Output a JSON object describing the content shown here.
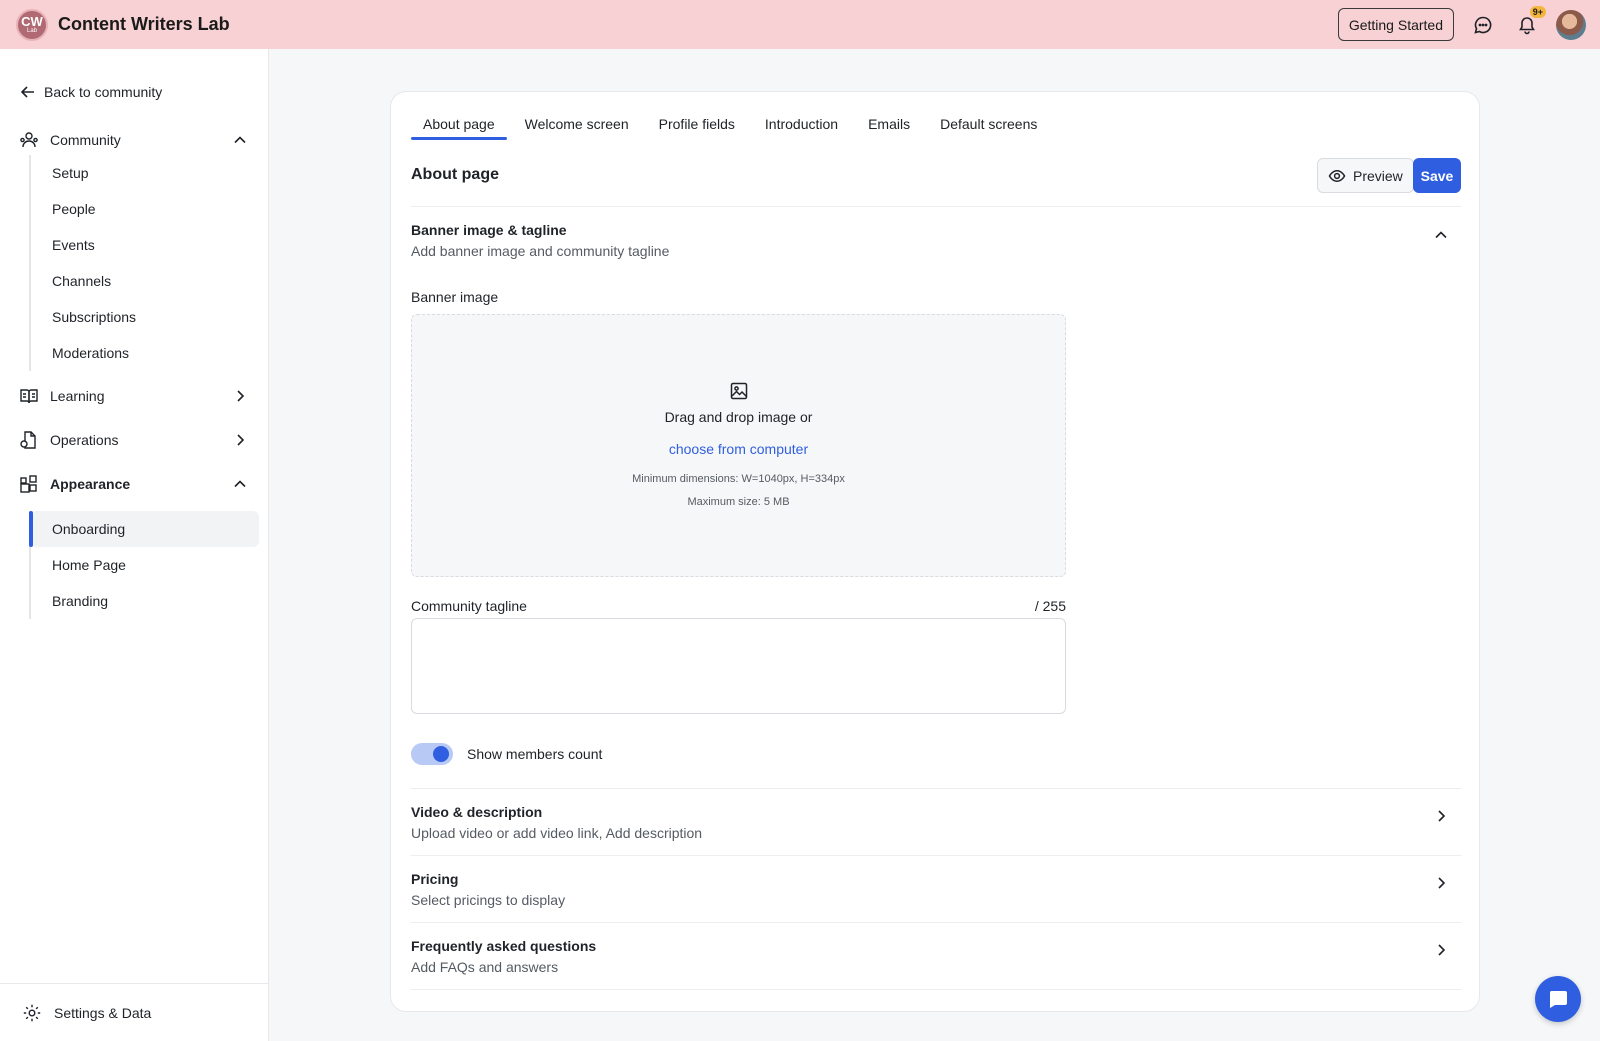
{
  "header": {
    "logo_line1": "CW",
    "logo_line2": "Lab",
    "brand": "Content Writers Lab",
    "getting_started": "Getting Started",
    "notification_badge": "9+",
    "icons": [
      "chat-icon",
      "bell-icon",
      "avatar"
    ]
  },
  "sidebar": {
    "back": "Back to community",
    "sections": {
      "community": {
        "label": "Community",
        "icon": "community-icon",
        "expanded": true,
        "items": [
          "Setup",
          "People",
          "Events",
          "Channels",
          "Subscriptions",
          "Moderations"
        ]
      },
      "learning": {
        "label": "Learning",
        "icon": "book-icon",
        "expanded": false
      },
      "operations": {
        "label": "Operations",
        "icon": "operations-icon",
        "expanded": false
      },
      "appearance": {
        "label": "Appearance",
        "icon": "appearance-icon",
        "expanded": true,
        "items": [
          "Onboarding",
          "Home Page",
          "Branding"
        ],
        "active": "Onboarding"
      }
    },
    "settings": "Settings & Data"
  },
  "main": {
    "tabs": [
      "About page",
      "Welcome screen",
      "Profile fields",
      "Introduction",
      "Emails",
      "Default screens"
    ],
    "active_tab": "About page",
    "title": "About page",
    "preview": "Preview",
    "save": "Save",
    "banner_section": {
      "title": "Banner image & tagline",
      "subtitle": "Add banner image and community tagline",
      "banner_label": "Banner image",
      "drop_text": "Drag and drop image or",
      "choose_link": "choose from computer",
      "min_dims": "Minimum dimensions: W=1040px, H=334px",
      "max_size": "Maximum size: 5 MB",
      "tagline_label": "Community tagline",
      "tagline_counter": "/ 255",
      "tagline_value": "",
      "show_members_label": "Show members count",
      "show_members_on": true
    },
    "video_section": {
      "title": "Video & description",
      "subtitle": "Upload video or add video link, Add description"
    },
    "pricing_section": {
      "title": "Pricing",
      "subtitle": "Select pricings to display"
    },
    "faq_section": {
      "title": "Frequently asked questions",
      "subtitle": "Add FAQs and answers"
    }
  },
  "colors": {
    "accent": "#2f5fe0",
    "header_bg": "#f7d1d4",
    "badge": "#f4b63f"
  }
}
